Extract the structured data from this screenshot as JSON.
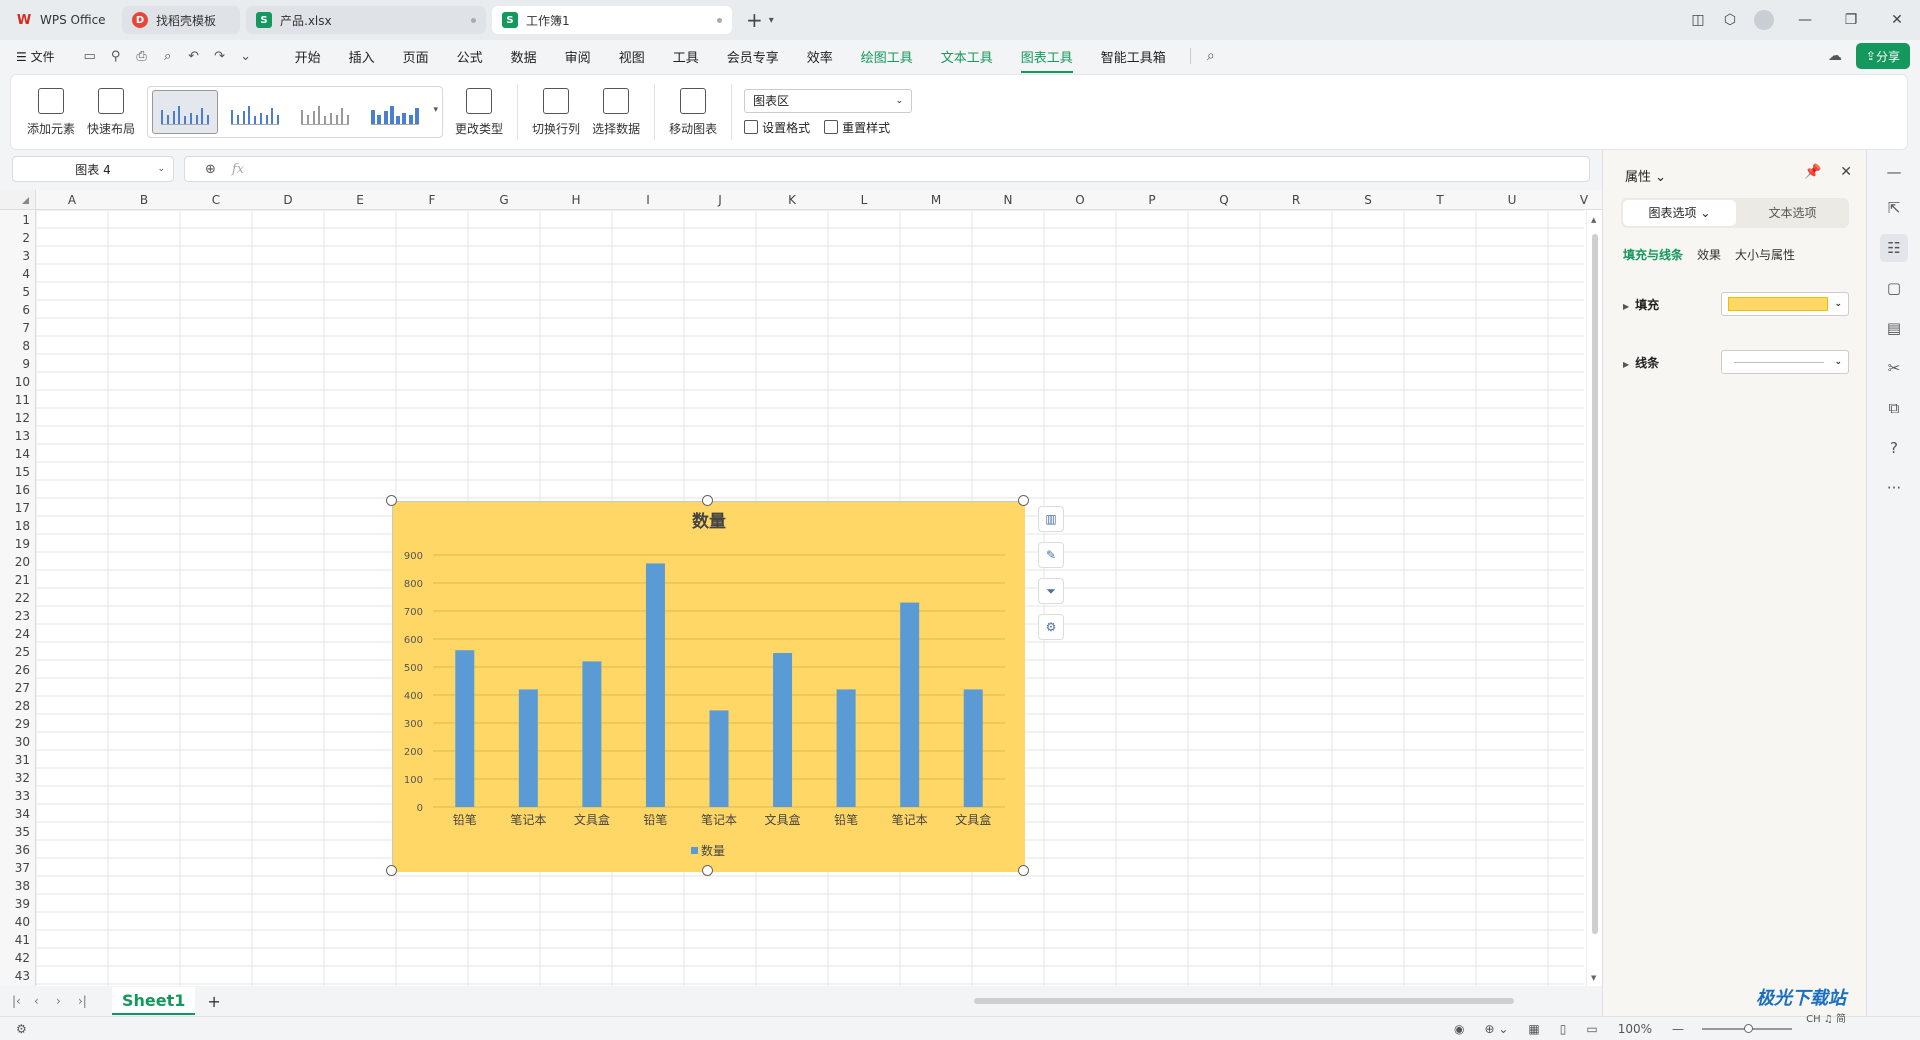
{
  "titlebar": {
    "tabs": [
      {
        "label": "WPS Office"
      },
      {
        "label": "找稻壳模板"
      },
      {
        "label": "产品.xlsx"
      },
      {
        "label": "工作簿1"
      }
    ]
  },
  "menu": {
    "file": "文件",
    "items": [
      "开始",
      "插入",
      "页面",
      "公式",
      "数据",
      "审阅",
      "视图",
      "工具",
      "会员专享",
      "效率"
    ],
    "tool_items": [
      "绘图工具",
      "文本工具",
      "图表工具",
      "智能工具箱"
    ],
    "share": "分享"
  },
  "ribbon": {
    "add_element": "添加元素",
    "quick_layout": "快速布局",
    "change_type": "更改类型",
    "switch_row_col": "切换行列",
    "select_data": "选择数据",
    "move_chart": "移动图表",
    "element_select": "图表区",
    "set_format": "设置格式",
    "reset_style": "重置样式"
  },
  "formula": {
    "name_box": "图表 4",
    "fx": "fx"
  },
  "sheet": {
    "columns": [
      "A",
      "B",
      "C",
      "D",
      "E",
      "F",
      "G",
      "H",
      "I",
      "J",
      "K",
      "L",
      "M",
      "N",
      "O",
      "P",
      "Q",
      "R",
      "S",
      "T",
      "U",
      "V"
    ],
    "rows_count": 43
  },
  "chart_data": {
    "type": "bar",
    "title": "数量",
    "categories": [
      "铅笔",
      "笔记本",
      "文具盒",
      "铅笔",
      "笔记本",
      "文具盒",
      "铅笔",
      "笔记本",
      "文具盒"
    ],
    "series": [
      {
        "name": "数量",
        "values": [
          560,
          420,
          520,
          870,
          345,
          550,
          420,
          730,
          420
        ]
      }
    ],
    "yticks": [
      0,
      100,
      200,
      300,
      400,
      500,
      600,
      700,
      800,
      900
    ],
    "ylim": [
      0,
      900
    ],
    "grid": true,
    "legend": "bottom",
    "colors": {
      "background": "#ffd766",
      "bar": "#5b9bd5"
    }
  },
  "sheet_tabs": {
    "active": "Sheet1",
    "add": "+"
  },
  "statusbar": {
    "zoom": "100%"
  },
  "pane": {
    "title": "属性",
    "tab_chart": "图表选项",
    "tab_text": "文本选项",
    "sub_tabs": [
      "填充与线条",
      "效果",
      "大小与属性"
    ],
    "fill_label": "填充",
    "line_label": "线条",
    "fill_color": "#ffd766"
  },
  "watermark": {
    "text": "极光下载站",
    "sub": "CH ♫ 简"
  }
}
